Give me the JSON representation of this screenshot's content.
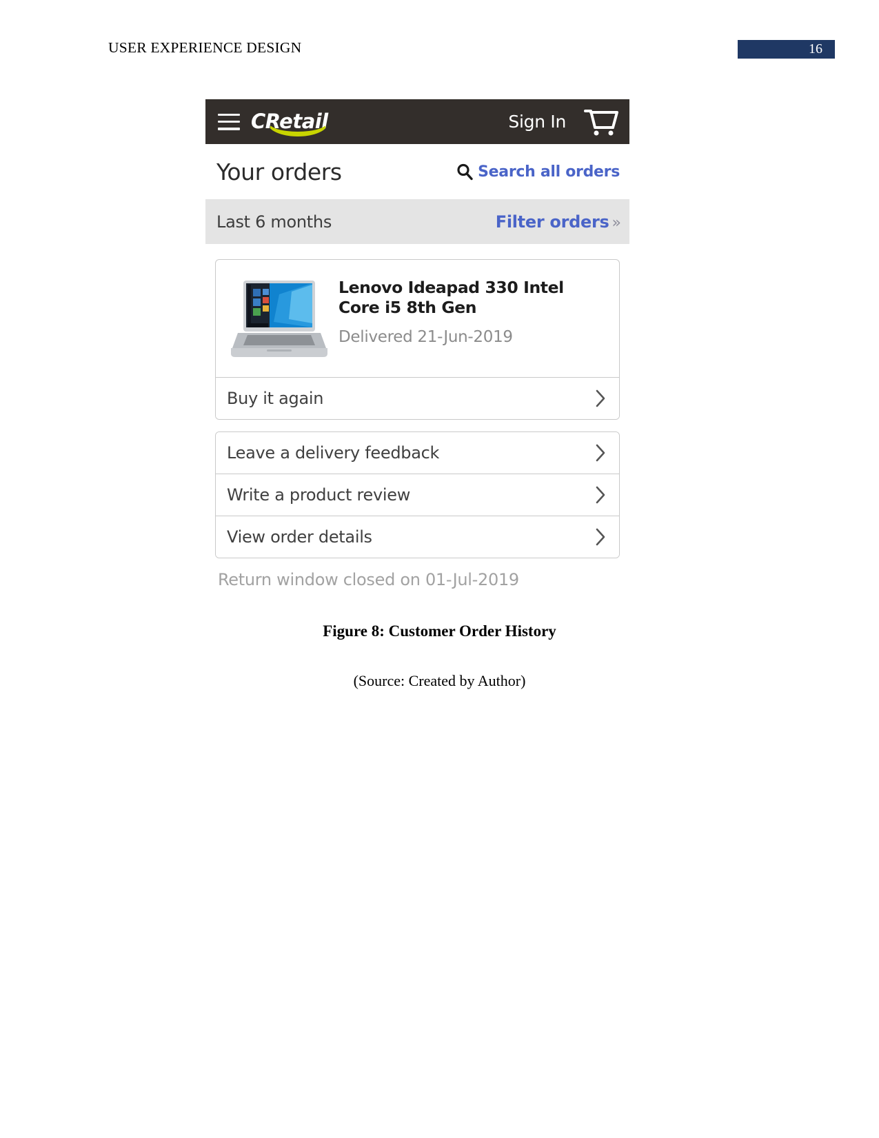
{
  "document": {
    "running_head": "USER EXPERIENCE DESIGN",
    "page_number": "16",
    "page_number_bg": "#1f3864",
    "figure_caption": "Figure 8: Customer Order History",
    "figure_source": "(Source: Created by Author)"
  },
  "app": {
    "header": {
      "menu_icon": "hamburger-menu-icon",
      "brand": "CRetail",
      "brand_accent_color": "#c8d400",
      "bar_color": "#332e2b",
      "sign_in_label": "Sign In",
      "cart_icon": "shopping-cart-icon"
    },
    "orders": {
      "page_title": "Your orders",
      "search_icon": "search-icon",
      "search_label": "Search all orders",
      "link_color": "#4a64c8"
    },
    "filter": {
      "range_label": "Last 6 months",
      "filter_label": "Filter orders",
      "chevrons": "»",
      "bar_color": "#e4e4e4"
    },
    "order": {
      "thumbnail_icon": "laptop-product-image",
      "product_title": "Lenovo Ideapad 330 Intel Core i5 8th Gen",
      "status": "Delivered 21-Jun-2019",
      "buy_again_label": "Buy it again",
      "actions": [
        {
          "label": "Leave a delivery feedback",
          "chevron": "chevron-right-icon"
        },
        {
          "label": "Write a product review",
          "chevron": "chevron-right-icon"
        },
        {
          "label": "View order details",
          "chevron": "chevron-right-icon"
        }
      ],
      "return_note": "Return window closed on 01-Jul-2019"
    }
  }
}
